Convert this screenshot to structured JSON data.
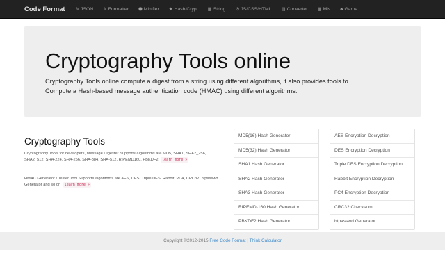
{
  "navbar": {
    "brand": "Code Format",
    "items": [
      {
        "label": "JSON",
        "icon": "✎"
      },
      {
        "label": "Formatter",
        "icon": "✎"
      },
      {
        "label": "Minifier",
        "icon": "⬣"
      },
      {
        "label": "Hash/Crypt",
        "icon": "★"
      },
      {
        "label": "String",
        "icon": "▦"
      },
      {
        "label": "JS/CSS/HTML",
        "icon": "⚙"
      },
      {
        "label": "Converter",
        "icon": "▤"
      },
      {
        "label": "Mis",
        "icon": "▦"
      },
      {
        "label": "Game",
        "icon": "♣"
      }
    ]
  },
  "hero": {
    "title": "Cryptography Tools online",
    "desc_line1": "Cryptography Tools online compute a digest from a string using different algorithms, it also provides tools to",
    "desc_line2": "Compute a Hash-based message authentication code (HMAC) using different algorithms."
  },
  "section": {
    "title": "Cryptography Tools",
    "desc1": "Cryptography Tools for developers, Message Digester Supports algorithms are MD5, SHA1, SHA2_256, SHA2_512, SHA-224, SHA-256, SHA-384, SHA-512, RIPEMD160, PBKDF2",
    "learn_more_1": "learn more »",
    "desc2": "HMAC Generator / Tester Tool Supports algorithms are AES, DES, Triple DES, Rabbit, PC4, CRC32, htpasswd Generator and so on",
    "learn_more_2": "learn more »"
  },
  "list_a": [
    "MD5(16) Hash Generator",
    "MD5(32) Hash Generator",
    "SHA1 Hash Generator",
    "SHA2 Hash Generator",
    "SHA3 Hash Generator",
    "RIPEMD-160 Hash Generator",
    "PBKDF2 Hash Generator"
  ],
  "list_b": [
    "AES Encryption Decryption",
    "DES Encryption Decryption",
    "Triple DES Encryption Decryption",
    "Rabbit Encryption Decryption",
    "PC4 Encryption Decryption",
    "CRC32 Checksum",
    "htpasswd Generator"
  ],
  "footer": {
    "prefix": "Copyright ©2012-2015 ",
    "link1": "Free Code Format",
    "sep": " | ",
    "link2": "Think Calculator"
  }
}
